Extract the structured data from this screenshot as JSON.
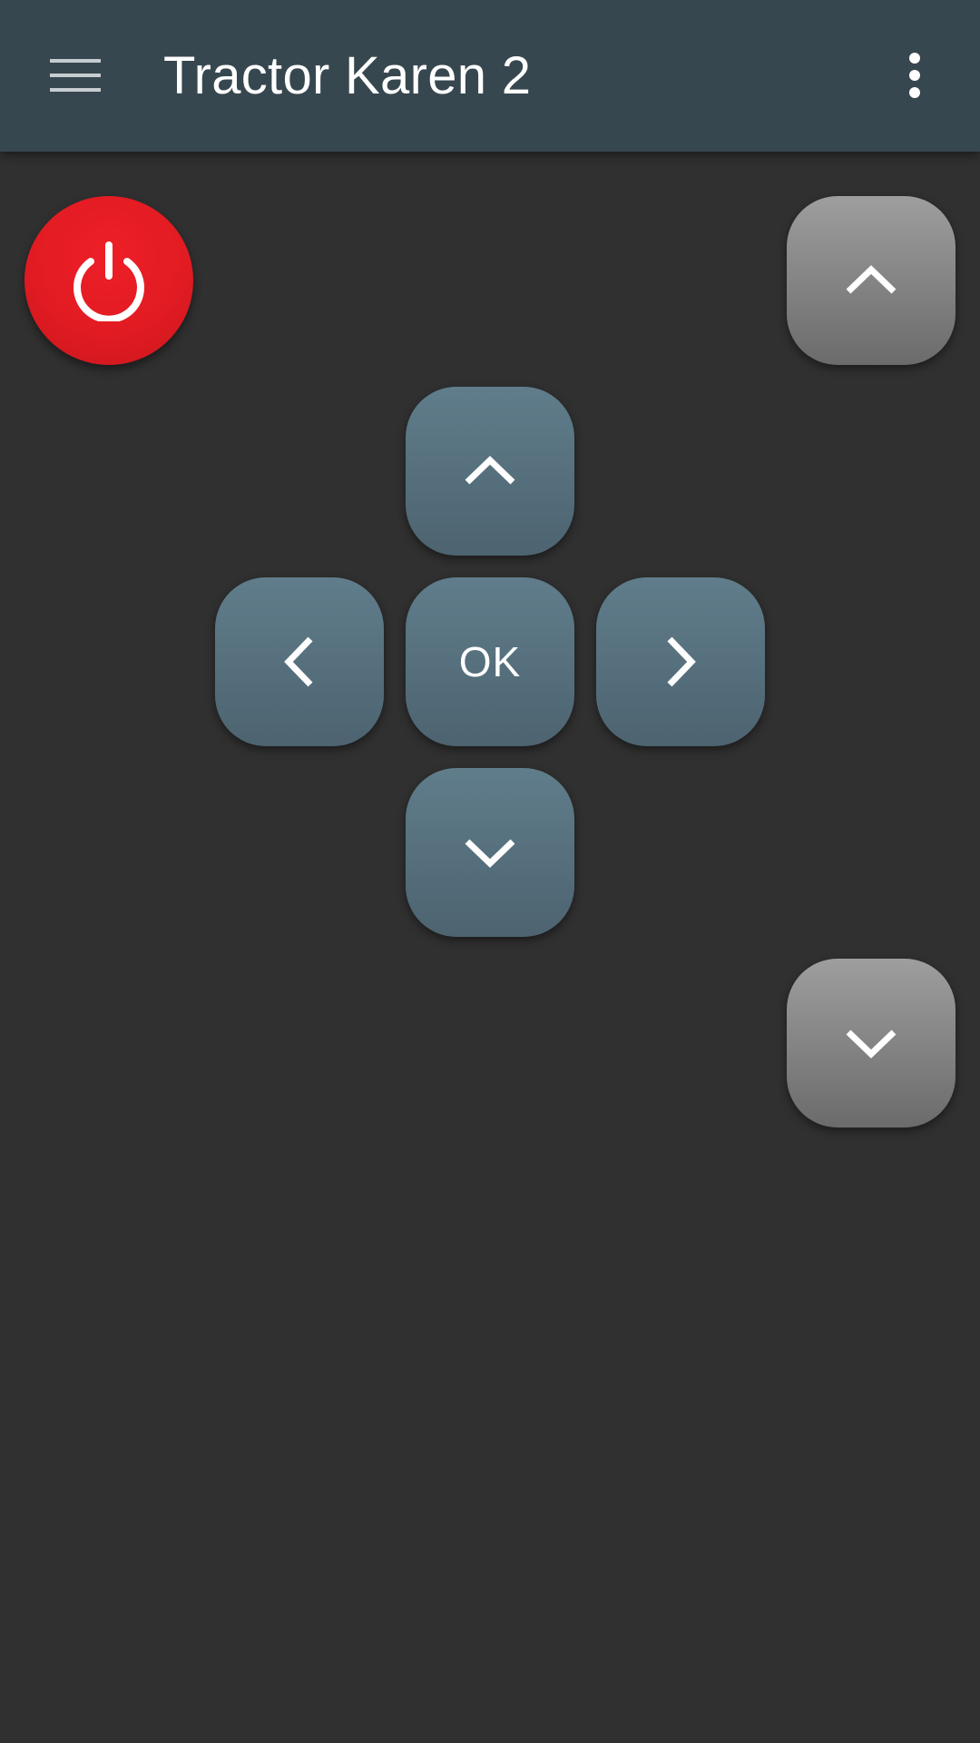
{
  "app_bar": {
    "title": "Tractor Karen 2",
    "menu_icon": "hamburger-menu-icon",
    "overflow_icon": "more-vert-icon",
    "background": "#37474f"
  },
  "remote": {
    "power": {
      "icon": "power-icon",
      "color": "#e21b22"
    },
    "channel_up": {
      "icon": "chevron-up-icon"
    },
    "channel_down": {
      "icon": "chevron-down-icon"
    },
    "dpad": {
      "up": {
        "icon": "chevron-up-icon"
      },
      "left": {
        "icon": "chevron-left-icon"
      },
      "ok_label": "OK",
      "right": {
        "icon": "chevron-right-icon"
      },
      "down": {
        "icon": "chevron-down-icon"
      },
      "color": "#546e7a"
    }
  },
  "page_background": "#303030"
}
